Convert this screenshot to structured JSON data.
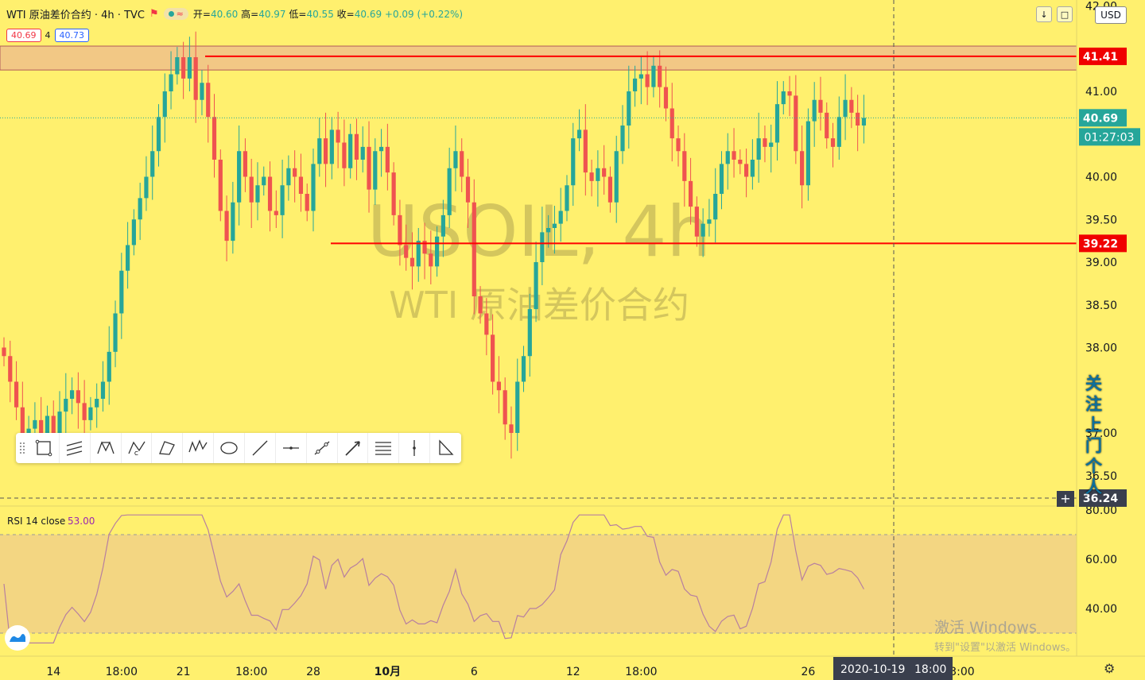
{
  "header": {
    "symbol_line": "WTI 原油差价合约 · 4h · TVC",
    "open_label": "开",
    "open": "40.60",
    "high_label": "高",
    "high": "40.97",
    "low_label": "低",
    "low": "40.55",
    "close_label": "收",
    "close": "40.69",
    "change": "+0.09 (+0.22%)",
    "bid": "40.69",
    "spread": "4",
    "ask": "40.73"
  },
  "currency": "USD",
  "watermark": {
    "symbol": "USOIL, 4h",
    "name": "WTI 原油差价合约"
  },
  "price_tags": {
    "resistance": "41.41",
    "last": "40.69",
    "countdown": "01:27:03",
    "support": "39.22",
    "crosshair": "36.24"
  },
  "crosshair_time": {
    "date": "2020-10-19",
    "time": "18:00"
  },
  "rsi": {
    "label": "RSI 14 close",
    "value": "53.00"
  },
  "side_note": "关注上门个人",
  "watermark_os": {
    "line1": "激活 Windows",
    "line2": "转到\"设置\"以激活 Windows。"
  },
  "colors": {
    "bg": "#fff06e",
    "up": "#26a69a",
    "down": "#ef5350",
    "level": "#ff0000",
    "zone": "#f2c885",
    "rsi_line": "#b77fa0"
  },
  "toolbar": {
    "tools": [
      "rectangle-icon",
      "parallel-channel-icon",
      "xabcd-pattern-icon",
      "abcd-pattern-icon",
      "triangle-pattern-icon",
      "elliott-wave-icon",
      "ellipse-icon",
      "trend-line-icon",
      "horizontal-line-icon",
      "trend-line-dots-icon",
      "arrow-line-icon",
      "fib-retracement-icon",
      "vertical-line-icon",
      "triangle-icon"
    ]
  },
  "chart_data": {
    "type": "candlestick",
    "title": "WTI 原油差价合约 · 4h · TVC",
    "ylim": [
      36.2,
      42.0
    ],
    "y_ticks": [
      36.5,
      37.0,
      37.5,
      38.0,
      38.5,
      39.0,
      39.5,
      40.0,
      40.5,
      41.0,
      41.5,
      42.0
    ],
    "y_tick_labels": [
      "36.50",
      "37.00",
      "",
      "38.00",
      "38.50",
      "39.00",
      "39.50",
      "40.00",
      "40.50",
      "41.00",
      "",
      "42.00"
    ],
    "x_tick_labels": [
      "14",
      "18:00",
      "21",
      "18:00",
      "28",
      "10月",
      "6",
      "12",
      "18:00",
      "",
      "26"
    ],
    "x_tick_index": [
      8,
      19,
      29,
      40,
      50,
      62,
      76,
      92,
      103,
      114,
      130
    ],
    "levels": [
      {
        "name": "resistance",
        "value": 41.41
      },
      {
        "name": "support",
        "value": 39.22
      }
    ],
    "zone": [
      41.25,
      41.53
    ],
    "close": [
      37.9,
      37.6,
      37.3,
      37.0,
      37.05,
      37.15,
      37.0,
      37.2,
      37.0,
      37.25,
      37.4,
      37.5,
      37.35,
      37.15,
      37.3,
      37.4,
      37.6,
      37.95,
      38.4,
      38.9,
      39.2,
      39.5,
      39.75,
      40.0,
      40.3,
      40.7,
      41.0,
      41.2,
      41.4,
      41.15,
      41.4,
      40.9,
      41.1,
      40.7,
      40.2,
      39.6,
      39.25,
      39.7,
      40.3,
      40.0,
      39.7,
      39.9,
      40.0,
      39.6,
      39.55,
      39.9,
      40.1,
      40.0,
      39.8,
      39.6,
      40.15,
      40.45,
      40.15,
      40.55,
      40.4,
      40.1,
      40.5,
      40.2,
      40.35,
      39.85,
      40.3,
      40.35,
      40.05,
      39.55,
      39.2,
      39.05,
      38.95,
      39.25,
      39.1,
      38.95,
      39.3,
      39.55,
      40.1,
      40.3,
      40.0,
      39.7,
      38.6,
      38.4,
      38.15,
      37.6,
      37.5,
      37.1,
      37.0,
      37.6,
      37.9,
      38.45,
      39.0,
      39.35,
      39.4,
      39.45,
      39.6,
      39.9,
      40.45,
      40.55,
      40.05,
      39.95,
      40.1,
      40.0,
      39.7,
      40.3,
      40.6,
      41.0,
      41.15,
      41.2,
      41.05,
      41.3,
      41.05,
      40.8,
      40.45,
      40.3,
      39.95,
      39.65,
      39.3,
      39.45,
      39.5,
      39.8,
      40.15,
      40.3,
      40.2,
      40.15,
      40.0,
      40.2,
      40.45,
      40.35,
      40.4,
      40.85,
      41.0,
      40.95,
      40.3,
      39.9,
      40.65,
      40.9,
      40.75,
      40.45,
      40.35,
      40.7,
      40.9,
      40.75,
      40.6,
      40.69
    ]
  }
}
